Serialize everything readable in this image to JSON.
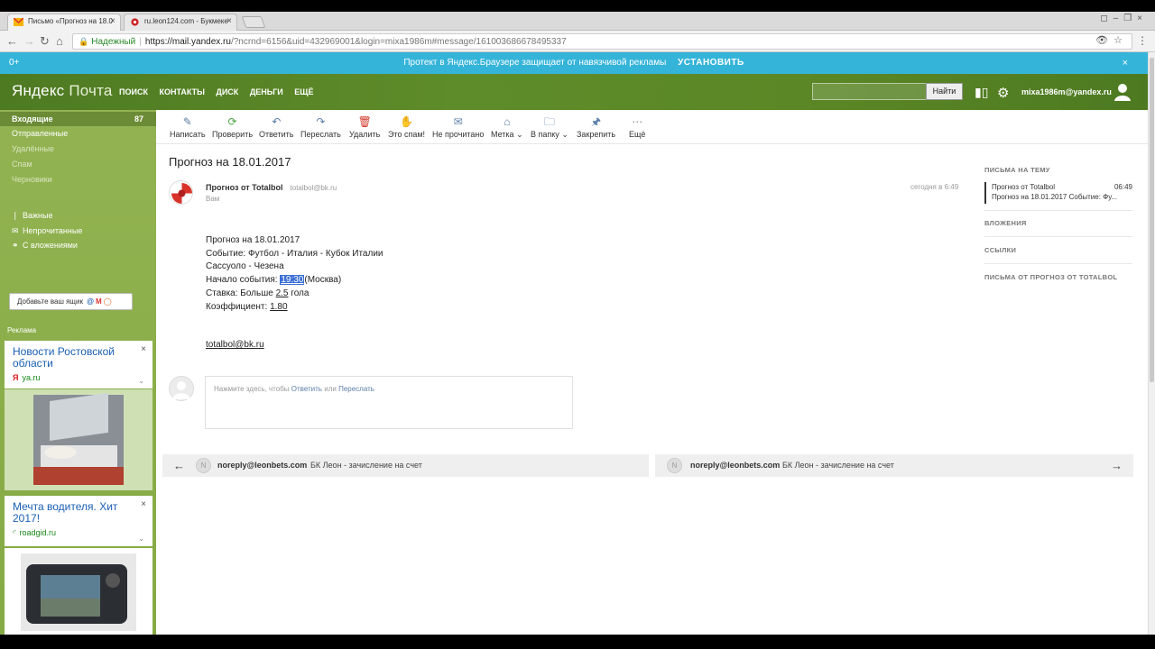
{
  "browser": {
    "tabs": [
      {
        "title": "Письмо «Прогноз на 18.0"
      },
      {
        "title": "ru.leon124.com - Букмеке"
      }
    ],
    "secure_label": "Надежный",
    "url_host": "https://mail.yandex.ru",
    "url_rest": "/?ncrnd=6156&uid=432969001&login=mixa1986m#message/161003686678495337"
  },
  "promo": {
    "plus": "0+",
    "text": "Протект в Яндекс.Браузере защищает от навязчивой рекламы",
    "install": "УСТАНОВИТЬ"
  },
  "header": {
    "logo_brand": "Яндекс",
    "logo_service": "Почта",
    "nav": [
      "ПОИСК",
      "КОНТАКТЫ",
      "ДИСК",
      "ДЕНЬГИ",
      "ЕЩЁ"
    ],
    "find_label": "Найти",
    "user": "mixa1986m@yandex.ru"
  },
  "sidebar": {
    "folders": [
      {
        "label": "Входящие",
        "count": "87"
      },
      {
        "label": "Отправленные"
      },
      {
        "label": "Удалённые"
      },
      {
        "label": "Спам"
      },
      {
        "label": "Черновики"
      }
    ],
    "filters": [
      "Важные",
      "Непрочитанные",
      "С вложениями"
    ],
    "add_mailbox": "Добавьте ваш ящик",
    "ads_label": "Реклама",
    "ads": [
      {
        "title": "Новости Ростовской области",
        "source": "ya.ru"
      },
      {
        "title": "Мечта водителя. Хит 2017!",
        "source": "roadgid.ru"
      }
    ]
  },
  "toolbar": {
    "items": [
      "Написать",
      "Проверить",
      "Ответить",
      "Переслать",
      "Удалить",
      "Это спам!",
      "Не прочитано",
      "Метка",
      "В папку",
      "Закрепить",
      "Ещё"
    ]
  },
  "message": {
    "subject": "Прогноз на 18.01.2017",
    "sender_name": "Прогноз от Totalbol",
    "sender_email": "totalbol@bk.ru",
    "to": "Вам",
    "date": "сегодня в 6:49",
    "lines": {
      "l1": "Прогноз на 18.01.2017",
      "l2": "Событие: Футбол - Италия - Кубок Италии",
      "l3": "Сассуоло - Чезена",
      "l4_prefix": "Начало события:",
      "l4_time": "19:30",
      "l4_suffix": "(Москва)",
      "l5_prefix": "Ставка: Больше",
      "l5_value": "2.5",
      "l5_suffix": "гола",
      "l6_prefix": "Коэффициент:",
      "l6_value": "1.80"
    },
    "footer_link": "totalbol@bk.ru"
  },
  "reply": {
    "prefix": "Нажмите здесь, чтобы",
    "reply_link": "Ответить",
    "or": "или",
    "forward_link": "Переслать"
  },
  "neighbors": {
    "prev": {
      "email": "noreply@leonbets.com",
      "subject": "БК Леон - зачисление на счет"
    },
    "next": {
      "email": "noreply@leonbets.com",
      "subject": "БК Леон - зачисление на счет"
    }
  },
  "right_panel": {
    "thread_header": "ПИСЬМА НА ТЕМУ",
    "thread_item": {
      "from": "Прогноз от Totalbol",
      "time": "06:49",
      "snippet": "Прогноз на 18.01.2017 Событие: Фу..."
    },
    "attachments_header": "ВЛОЖЕНИЯ",
    "links_header": "ССЫЛКИ",
    "from_sender_header": "ПИСЬМА ОТ ПРОГНОЗ ОТ TOTALBOL"
  }
}
